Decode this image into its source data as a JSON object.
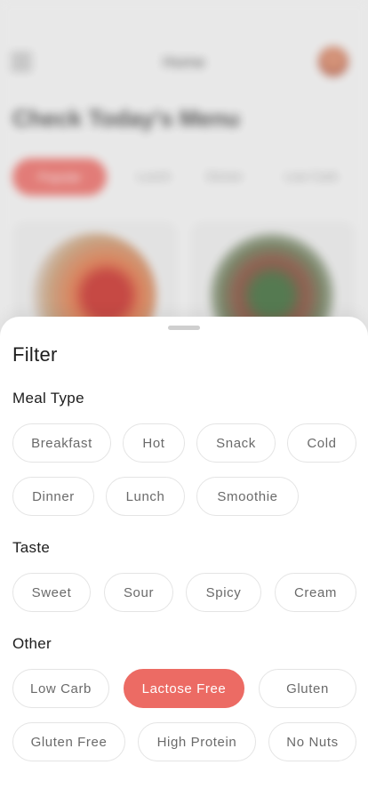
{
  "background": {
    "title": "Home",
    "heading": "Check Today's Menu",
    "categories": [
      "Popular",
      "Lunch",
      "Dinner",
      "Low Carb"
    ]
  },
  "filter": {
    "title": "Filter",
    "sections": [
      {
        "title": "Meal Type",
        "options": [
          "Breakfast",
          "Hot",
          "Snack",
          "Cold",
          "Dinner",
          "Lunch",
          "Smoothie"
        ]
      },
      {
        "title": "Taste",
        "options": [
          "Sweet",
          "Sour",
          "Spicy",
          "Cream"
        ]
      },
      {
        "title": "Other",
        "options": [
          "Low Carb",
          "Lactose Free",
          "Gluten",
          "Gluten Free",
          "High Protein",
          "No Nuts"
        ]
      }
    ],
    "selected": [
      "Lactose Free"
    ]
  },
  "colors": {
    "accent": "#ec6b64",
    "chip_border": "#e4e4e4",
    "chip_text": "#6a6a6a"
  }
}
